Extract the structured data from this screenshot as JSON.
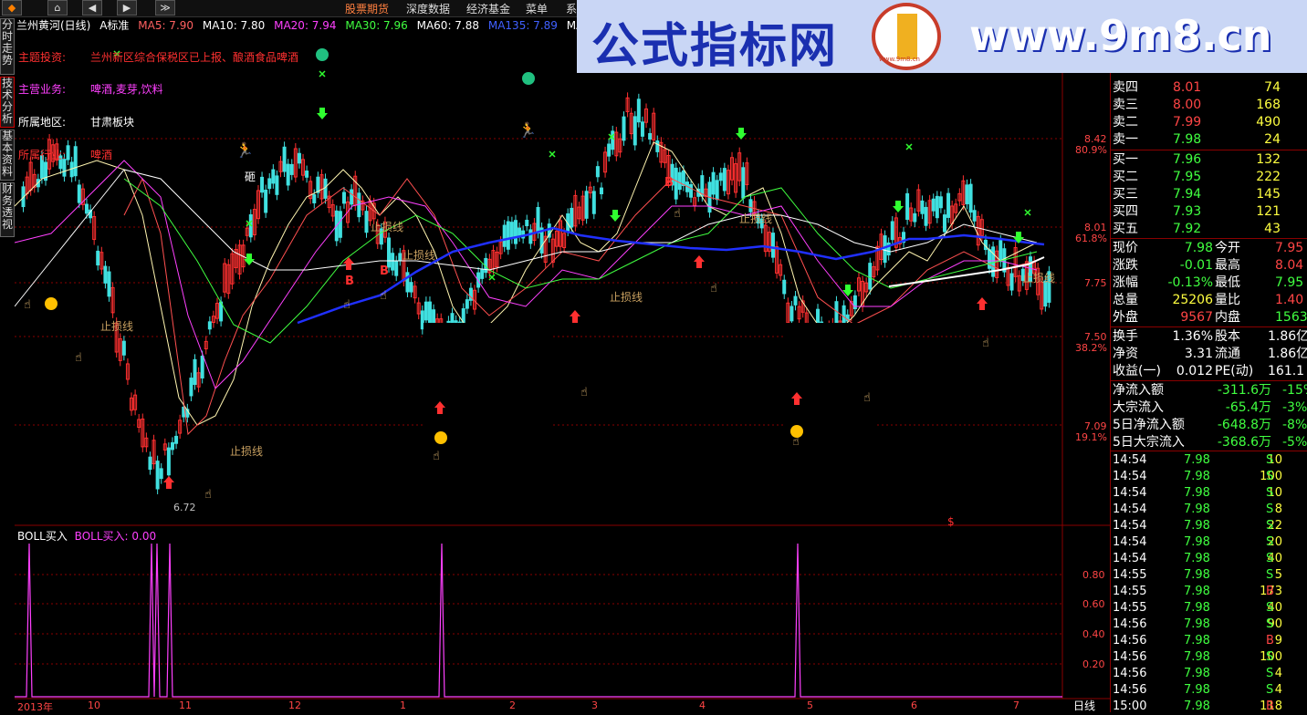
{
  "toolbar": {
    "menus": [
      "股票期货",
      "深度数据",
      "经济基金",
      "菜单",
      "系"
    ]
  },
  "infobar": {
    "title": "兰州黄河(日线)",
    "adjust": "A标准",
    "ma5": "MA5: 7.90",
    "ma10": "MA10: 7.80",
    "ma20": "MA20: 7.94",
    "ma30": "MA30: 7.96",
    "ma60": "MA60: 7.88",
    "ma135": "MA135: 7.89",
    "ma250": "MA250"
  },
  "left_tabs": [
    "分时走势",
    "技术分析",
    "基本资料",
    "财务透视"
  ],
  "banner": {
    "cn": "公式指标网",
    "url": "www.9m8.cn",
    "logo_text": "www.9m8.cn"
  },
  "stock_info": [
    {
      "label": "主题投资:",
      "value": "兰州新区综合保税区已上报、酿酒食品啤酒"
    },
    {
      "label": "主营业务:",
      "value": "啤酒,麦芽,饮料"
    },
    {
      "label": "所属地区:",
      "value": "甘肃板块"
    },
    {
      "label": "所属行业:",
      "value": "啤酒"
    }
  ],
  "chart_marks": {
    "stop_loss": "止损线",
    "low_price": "6.72",
    "buy": "B",
    "smash": "砸",
    "dollar": "$"
  },
  "price_axis": {
    "labels": [
      "8.42",
      "80.9%",
      "8.01",
      "61.8%",
      "7.75",
      "7.50",
      "38.2%",
      "7.09",
      "19.1%"
    ]
  },
  "indicator": {
    "name": "BOLL买入",
    "value": "BOLL买入: 0.00",
    "axis": [
      "0.80",
      "0.60",
      "0.40",
      "0.20"
    ]
  },
  "chart_data": {
    "type": "line",
    "title": "BOLL买入",
    "ylim": [
      0,
      1
    ],
    "spikes_at": [
      "2013-10",
      "2013-11",
      "2013-11",
      "2013-11",
      "2014-02",
      "2014-05"
    ],
    "values": [
      1,
      1,
      1,
      1,
      1,
      1
    ]
  },
  "date_axis": [
    "2013年",
    "10",
    "11",
    "12",
    "1",
    "2",
    "3",
    "4",
    "5",
    "6",
    "7"
  ],
  "period": "日线",
  "order_book": {
    "sell": [
      {
        "label": "卖四",
        "price": "8.01",
        "vol": "74"
      },
      {
        "label": "卖三",
        "price": "8.00",
        "vol": "168"
      },
      {
        "label": "卖二",
        "price": "7.99",
        "vol": "490"
      },
      {
        "label": "卖一",
        "price": "7.98",
        "vol": "24"
      }
    ],
    "buy": [
      {
        "label": "买一",
        "price": "7.96",
        "vol": "132"
      },
      {
        "label": "买二",
        "price": "7.95",
        "vol": "222"
      },
      {
        "label": "买三",
        "price": "7.94",
        "vol": "145"
      },
      {
        "label": "买四",
        "price": "7.93",
        "vol": "121"
      },
      {
        "label": "买五",
        "price": "7.92",
        "vol": "43"
      }
    ]
  },
  "quote": [
    {
      "l1": "现价",
      "v1": "7.98",
      "l2": "今开",
      "v2": "7.95"
    },
    {
      "l1": "涨跌",
      "v1": "-0.01",
      "l2": "最高",
      "v2": "8.04"
    },
    {
      "l1": "涨幅",
      "v1": "-0.13%",
      "l2": "最低",
      "v2": "7.95"
    },
    {
      "l1": "总量",
      "v1": "25206",
      "l2": "量比",
      "v2": "1.40"
    },
    {
      "l1": "外盘",
      "v1": "9567",
      "l2": "内盘",
      "v2": "15639"
    }
  ],
  "fundamentals": [
    {
      "l1": "换手",
      "v1": "1.36%",
      "l2": "股本",
      "v2": "1.86亿"
    },
    {
      "l1": "净资",
      "v1": "3.31",
      "l2": "流通",
      "v2": "1.86亿"
    },
    {
      "l1": "收益(一)",
      "v1": "0.012",
      "l2": "PE(动)",
      "v2": "161.1"
    }
  ],
  "flows": [
    {
      "label": "净流入额",
      "v1": "-311.6万",
      "v2": "-15%"
    },
    {
      "label": "大宗流入",
      "v1": "-65.4万",
      "v2": "-3%"
    },
    {
      "label": "5日净流入额",
      "v1": "-648.8万",
      "v2": "-8%"
    },
    {
      "label": "5日大宗流入",
      "v1": "-368.6万",
      "v2": "-5%"
    }
  ],
  "ticks": [
    {
      "t": "14:54",
      "p": "7.98",
      "v": "10",
      "s": "S"
    },
    {
      "t": "14:54",
      "p": "7.98",
      "v": "100",
      "s": "S"
    },
    {
      "t": "14:54",
      "p": "7.98",
      "v": "10",
      "s": "S"
    },
    {
      "t": "14:54",
      "p": "7.98",
      "v": "8",
      "s": "S"
    },
    {
      "t": "14:54",
      "p": "7.98",
      "v": "22",
      "s": "S"
    },
    {
      "t": "14:54",
      "p": "7.98",
      "v": "20",
      "s": "S"
    },
    {
      "t": "14:54",
      "p": "7.98",
      "v": "40",
      "s": "S"
    },
    {
      "t": "14:55",
      "p": "7.98",
      "v": "5",
      "s": "S"
    },
    {
      "t": "14:55",
      "p": "7.98",
      "v": "173",
      "s": "B"
    },
    {
      "t": "14:55",
      "p": "7.98",
      "v": "40",
      "s": "S"
    },
    {
      "t": "14:56",
      "p": "7.98",
      "v": "90",
      "s": "S"
    },
    {
      "t": "14:56",
      "p": "7.98",
      "v": "9",
      "s": "B"
    },
    {
      "t": "14:56",
      "p": "7.98",
      "v": "100",
      "s": "S"
    },
    {
      "t": "14:56",
      "p": "7.98",
      "v": "4",
      "s": "S"
    },
    {
      "t": "14:56",
      "p": "7.98",
      "v": "4",
      "s": "S"
    },
    {
      "t": "15:00",
      "p": "7.98",
      "v": "118",
      "s": "B"
    }
  ]
}
